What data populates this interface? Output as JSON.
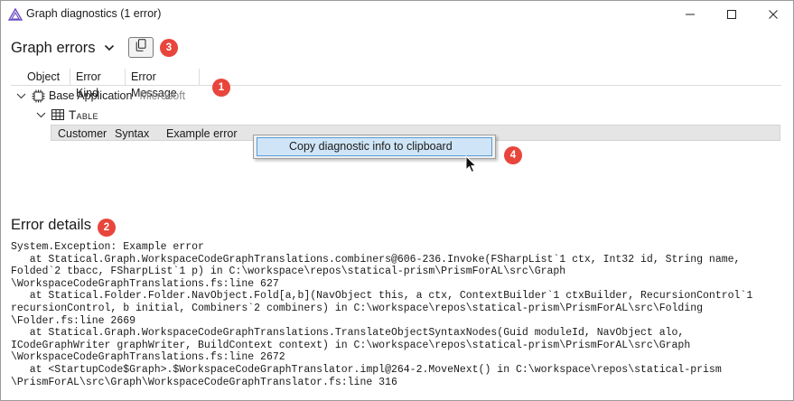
{
  "window": {
    "title": "Graph diagnostics (1 error)",
    "accent_color": "#6a4bc4"
  },
  "graph_errors": {
    "title": "Graph errors",
    "columns": [
      "Object",
      "Error Kind",
      "Error Message"
    ],
    "tree": {
      "root_label": "Base Application",
      "root_sub": "Microsoft",
      "child_label": "Table",
      "error_row": {
        "object": "Customer",
        "kind": "Syntax",
        "message": "Example error"
      }
    }
  },
  "context_menu": {
    "items": [
      "Copy diagnostic info to clipboard"
    ]
  },
  "badges": {
    "b1": "1",
    "b2": "2",
    "b3": "3",
    "b4": "4",
    "color": "#e8453c"
  },
  "error_details": {
    "title": "Error details",
    "lines": [
      "System.Exception: Example error",
      "   at Statical.Graph.WorkspaceCodeGraphTranslations.combiners@606-236.Invoke(FSharpList`1 ctx, Int32 id, String name,",
      "Folded`2 tbacc, FSharpList`1 p) in C:\\workspace\\repos\\statical-prism\\PrismForAL\\src\\Graph",
      "\\WorkspaceCodeGraphTranslations.fs:line 627",
      "   at Statical.Folder.Folder.NavObject.Fold[a,b](NavObject this, a ctx, ContextBuilder`1 ctxBuilder, RecursionControl`1",
      "recursionControl, b initial, Combiners`2 combiners) in C:\\workspace\\repos\\statical-prism\\PrismForAL\\src\\Folding",
      "\\Folder.fs:line 2669",
      "   at Statical.Graph.WorkspaceCodeGraphTranslations.TranslateObjectSyntaxNodes(Guid moduleId, NavObject alo,",
      "ICodeGraphWriter graphWriter, BuildContext context) in C:\\workspace\\repos\\statical-prism\\PrismForAL\\src\\Graph",
      "\\WorkspaceCodeGraphTranslations.fs:line 2672",
      "   at <StartupCode$Graph>.$WorkspaceCodeGraphTranslator.impl@264-2.MoveNext() in C:\\workspace\\repos\\statical-prism",
      "\\PrismForAL\\src\\Graph\\WorkspaceCodeGraphTranslator.fs:line 316"
    ]
  }
}
